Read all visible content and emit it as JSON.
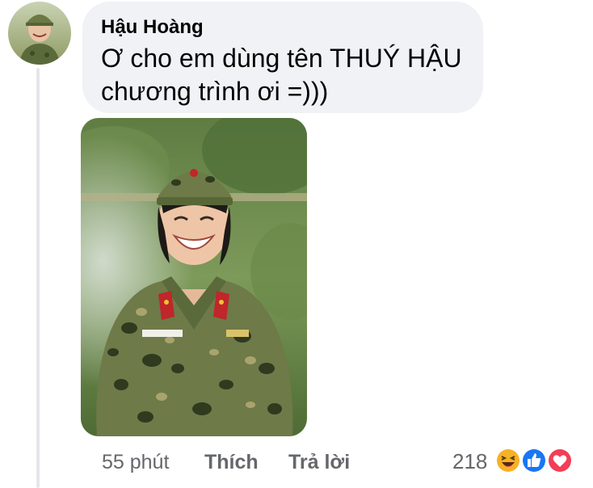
{
  "comment": {
    "author": "Hậu Hoàng",
    "text_lines": [
      "Ơ cho em dùng tên THUÝ HẬU",
      "chương trình ơi =)))"
    ]
  },
  "actions": {
    "time": "55 phút",
    "like_label": "Thích",
    "reply_label": "Trả lời"
  },
  "reactions": {
    "count": "218",
    "icons": [
      "haha-icon",
      "like-icon",
      "love-icon"
    ]
  },
  "colors": {
    "bubble": "#f0f2f5",
    "secondary_text": "#65676b",
    "like_blue": "#1877f2",
    "love_red": "#f33e58",
    "haha_yellow": "#f7b125"
  }
}
